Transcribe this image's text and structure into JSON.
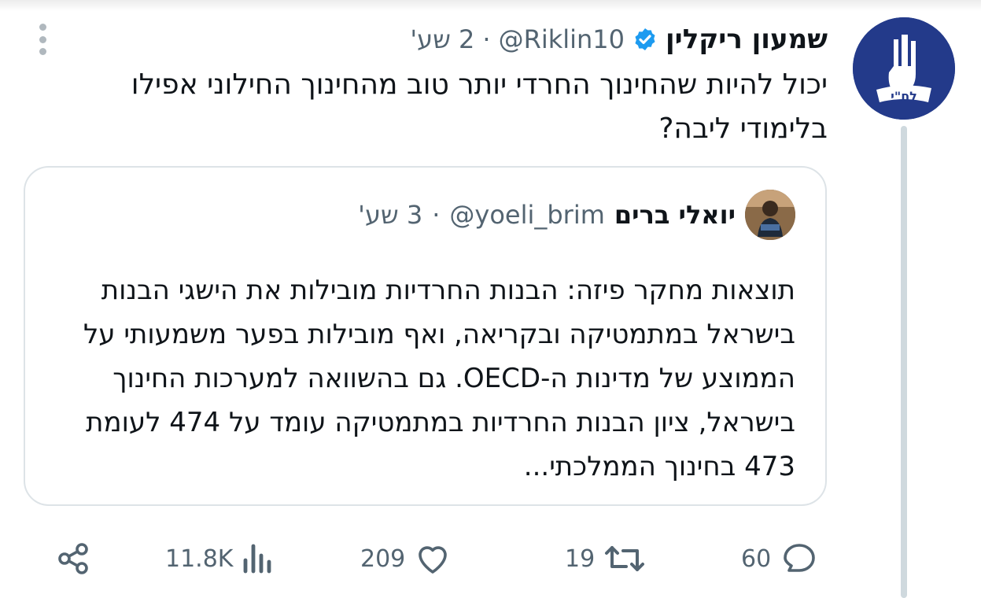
{
  "tweet": {
    "author_name": "שמעון ריקלין",
    "handle": "@Riklin10",
    "separator": "·",
    "time": "2 שע'",
    "text": "יכול להיות שהחינוך החרדי יותר טוב מהחינוך החילוני אפילו בלימודי ליבה?",
    "verified": true
  },
  "quote": {
    "author_name": "יואלי ברים",
    "handle": "@yoeli_brim",
    "separator": "·",
    "time": "3 שע'",
    "text": "תוצאות מחקר פיזה: הבנות החרדיות מובילות את הישגי הבנות בישראל במתמטיקה ובקריאה, ואף מובילות בפער משמעותי על הממוצע של מדינות ה-OECD. גם בהשוואה למערכות החינוך בישראל, ציון הבנות החרדיות במתמטיקה עומד על 474 לעומת 473 בחינוך הממלכתי..."
  },
  "avatar_badge_text": "לח\"י",
  "actions": {
    "views": "11.8K",
    "likes": "209",
    "retweets": "19",
    "replies": "60"
  },
  "colors": {
    "verified_blue": "#1d9bf0",
    "muted": "#536471",
    "avatar_blue": "#233a8a"
  },
  "icons": [
    "share-icon",
    "views-icon",
    "heart-icon",
    "retweet-icon",
    "reply-icon",
    "more-icon",
    "verified-icon"
  ]
}
